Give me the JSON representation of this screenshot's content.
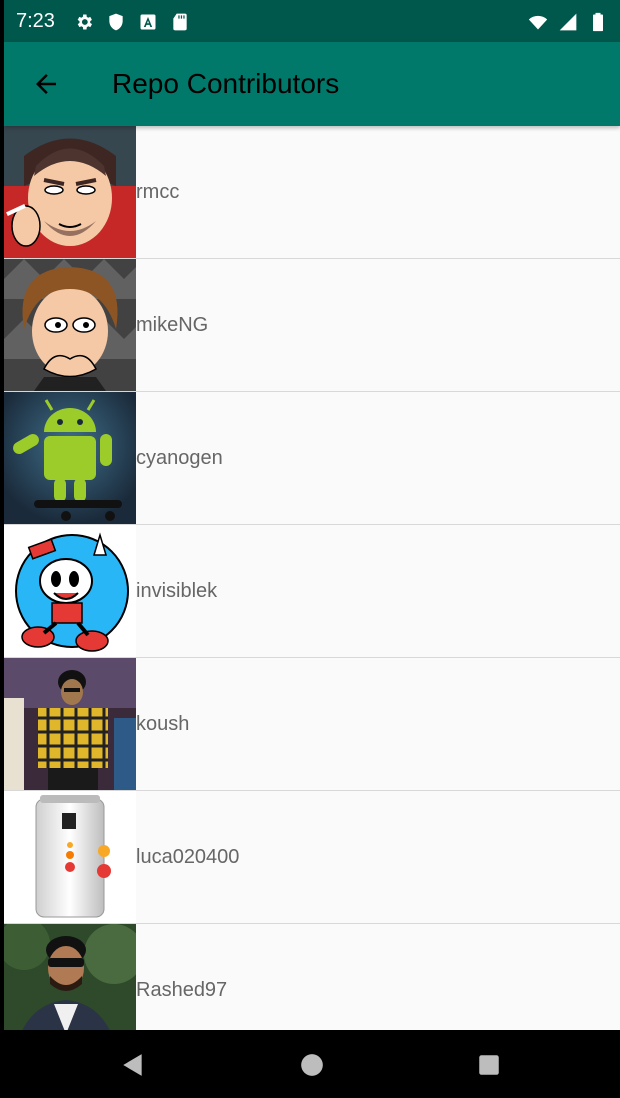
{
  "status_bar": {
    "time": "7:23",
    "left_icons": [
      "gear-icon",
      "shield-icon",
      "font-a-icon",
      "sd-card-icon"
    ],
    "right_icons": [
      "wifi-icon",
      "cell-signal-icon",
      "battery-icon"
    ]
  },
  "app_bar": {
    "title": "Repo Contributors",
    "back_icon": "arrow-back-icon"
  },
  "contributors": [
    {
      "username": "rmcc",
      "avatar": "cartoon-man-smoking"
    },
    {
      "username": "mikeNG",
      "avatar": "cartoon-man-brown-hair"
    },
    {
      "username": "cyanogen",
      "avatar": "android-robot"
    },
    {
      "username": "invisiblek",
      "avatar": "cuphead-cartoon"
    },
    {
      "username": "koush",
      "avatar": "photo-person-plaid-shirt"
    },
    {
      "username": "luca020400",
      "avatar": "ubuntu-cola-can"
    },
    {
      "username": "Rashed97",
      "avatar": "photo-man-sunglasses"
    }
  ],
  "nav_bar": {
    "back_icon": "triangle-back-icon",
    "home_icon": "circle-home-icon",
    "recents_icon": "square-recents-icon"
  },
  "colors": {
    "status_bar": "#00574B",
    "app_bar": "#00796B",
    "list_bg": "#fafafa",
    "text": "#666666"
  }
}
